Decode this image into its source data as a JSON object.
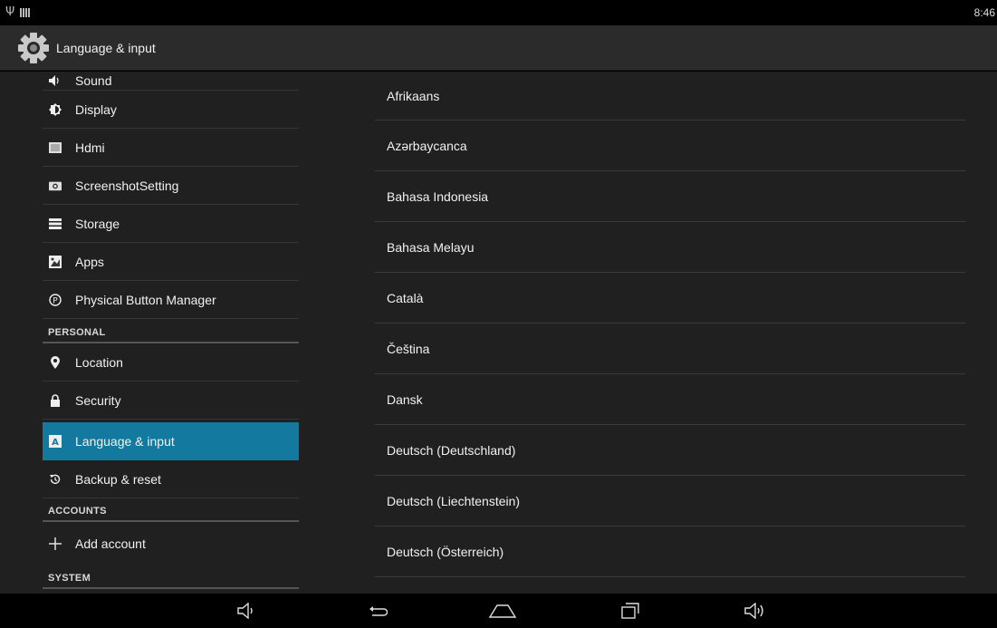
{
  "status_bar": {
    "time": "8:46",
    "icons": [
      "usb-icon",
      "signal-bars-icon"
    ]
  },
  "action_bar": {
    "icon": "settings-gear-icon",
    "title": "Language & input"
  },
  "sidebar": {
    "items": [
      {
        "type": "item",
        "label": "Sound",
        "icon": "sound-icon"
      },
      {
        "type": "item",
        "label": "Display",
        "icon": "display-brightness-icon"
      },
      {
        "type": "item",
        "label": "Hdmi",
        "icon": "hdmi-icon"
      },
      {
        "type": "item",
        "label": "ScreenshotSetting",
        "icon": "camera-icon"
      },
      {
        "type": "item",
        "label": "Storage",
        "icon": "storage-icon"
      },
      {
        "type": "item",
        "label": "Apps",
        "icon": "apps-icon"
      },
      {
        "type": "item",
        "label": "Physical Button Manager",
        "icon": "physical-button-icon"
      },
      {
        "type": "header",
        "label": "PERSONAL"
      },
      {
        "type": "item",
        "label": "Location",
        "icon": "location-pin-icon"
      },
      {
        "type": "item",
        "label": "Security",
        "icon": "lock-icon"
      },
      {
        "type": "item",
        "label": "Language & input",
        "icon": "language-icon",
        "selected": true
      },
      {
        "type": "item",
        "label": "Backup & reset",
        "icon": "backup-restore-icon"
      },
      {
        "type": "header",
        "label": "ACCOUNTS"
      },
      {
        "type": "item",
        "label": "Add account",
        "icon": "plus-icon"
      },
      {
        "type": "header",
        "label": "SYSTEM"
      }
    ]
  },
  "languages": [
    "Afrikaans",
    "Azərbaycanca",
    "Bahasa Indonesia",
    "Bahasa Melayu",
    "Català",
    "Čeština",
    "Dansk",
    "Deutsch (Deutschland)",
    "Deutsch (Liechtenstein)",
    "Deutsch (Österreich)"
  ],
  "nav_bar": {
    "buttons": [
      "volume-down-icon",
      "back-icon",
      "home-icon",
      "recent-apps-icon",
      "volume-up-icon"
    ]
  },
  "colors": {
    "selected": "#13799f",
    "background": "#202020",
    "action_bar": "#2b2b2b"
  }
}
